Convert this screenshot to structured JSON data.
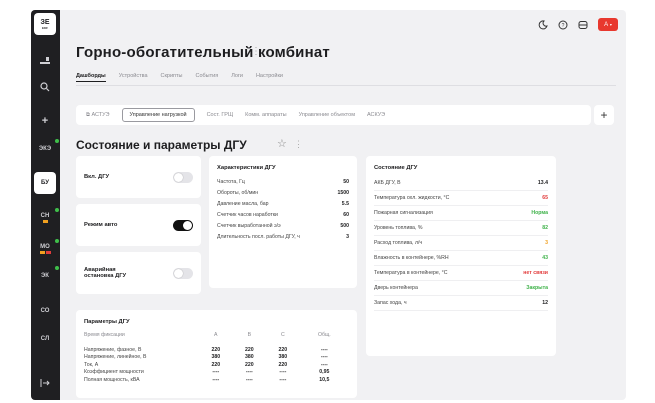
{
  "sidebar": {
    "logo": "ЗЕ",
    "items": [
      {
        "label": "ЭКЭ"
      },
      {
        "label": "БУ"
      },
      {
        "label": "СН"
      },
      {
        "label": "МО"
      },
      {
        "label": "ЭК"
      },
      {
        "label": "СО"
      },
      {
        "label": "СЛ"
      }
    ]
  },
  "header": {
    "title": "Горно-обогатительный комбинат",
    "user_initial": "А"
  },
  "tabs": [
    "Дашборды",
    "Устройства",
    "Скрипты",
    "События",
    "Логи",
    "Настройки"
  ],
  "subtabs": [
    "АСТУЭ",
    "Управление нагрузкой",
    "Сост. ГРЩ",
    "Комм. аппараты",
    "Управление объектом",
    "АСКУЭ"
  ],
  "section": {
    "title": "Состояние и параметры ДГУ"
  },
  "toggles": [
    {
      "label": "Вкл. ДГУ",
      "state": "off"
    },
    {
      "label": "Режим авто",
      "state": "on"
    },
    {
      "label": "Аварийная остановка ДГУ",
      "state": "off"
    }
  ],
  "characteristics": {
    "title": "Характеристики ДГУ",
    "rows": [
      {
        "label": "Частота, Гц",
        "value": "50"
      },
      {
        "label": "Обороты, об/мин",
        "value": "1500"
      },
      {
        "label": "Давление масла, бар",
        "value": "5.5"
      },
      {
        "label": "Счетчик часов наработки",
        "value": "60"
      },
      {
        "label": "Счетчик выработанной э/э",
        "value": "500"
      },
      {
        "label": "Длительность посл. работы ДГУ, ч",
        "value": "3"
      }
    ]
  },
  "state": {
    "title": "Состояние ДГУ",
    "rows": [
      {
        "label": "АКБ ДГУ, В",
        "value": "13.4",
        "color": "#1d1d1f"
      },
      {
        "label": "Температура охл. жидкости, °С",
        "value": "65",
        "color": "#e23b3b"
      },
      {
        "label": "Пожарная сигнализация",
        "value": "Норма",
        "color": "#3fb24a"
      },
      {
        "label": "Уровень топлива, %",
        "value": "82",
        "color": "#3fb24a"
      },
      {
        "label": "Расход топлива, л/ч",
        "value": "3",
        "color": "#f0a020"
      },
      {
        "label": "Влажность в контейнере, %RH",
        "value": "43",
        "color": "#3fb24a"
      },
      {
        "label": "Температура в контейнере, °С",
        "value": "нет связи",
        "color": "#e23b3b"
      },
      {
        "label": "Дверь контейнера",
        "value": "Закрыта",
        "color": "#3fb24a"
      },
      {
        "label": "Запас хода, ч",
        "value": "12",
        "color": "#1d1d1f"
      }
    ]
  },
  "params": {
    "title": "Параметры ДГУ",
    "headers": [
      "Время фиксации",
      "A",
      "B",
      "C",
      "Общ."
    ],
    "rows": [
      [
        "Напряжение, фазное, В",
        "220",
        "220",
        "220",
        "----"
      ],
      [
        "Напряжение, линейное, В",
        "380",
        "380",
        "380",
        "----"
      ],
      [
        "Ток, А",
        "220",
        "220",
        "220",
        "----"
      ],
      [
        "Коэффициент мощности",
        "----",
        "----",
        "----",
        "0,95"
      ],
      [
        "Полная мощность, кВА",
        "----",
        "----",
        "----",
        "10,5"
      ]
    ]
  }
}
